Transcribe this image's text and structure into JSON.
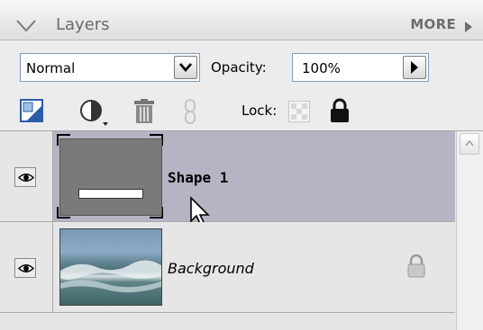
{
  "header": {
    "title": "Layers",
    "more_label": "MORE"
  },
  "controls": {
    "blend_mode": "Normal",
    "opacity_label": "Opacity:",
    "opacity_value": "100%",
    "lock_label": "Lock:"
  },
  "layers": [
    {
      "name": "Shape 1",
      "selected": true,
      "visible": true,
      "locked": false,
      "thumb": "gray-shape-with-white-bar"
    },
    {
      "name": "Background",
      "selected": false,
      "visible": true,
      "locked": true,
      "thumb": "ocean-wave-photo"
    }
  ],
  "icons": {
    "collapse": "triangle-down-icon",
    "more": "triangle-right-icon",
    "new_layer": "new-layer-icon",
    "adjustment": "adjustment-layer-icon",
    "delete": "trash-icon",
    "link": "link-icon",
    "lock_transparent": "lock-transparent-icon",
    "lock_all": "padlock-icon",
    "visibility": "eye-icon"
  },
  "colors": {
    "selected_row": "#b4b4c4",
    "header_text": "#6a6a6a"
  }
}
